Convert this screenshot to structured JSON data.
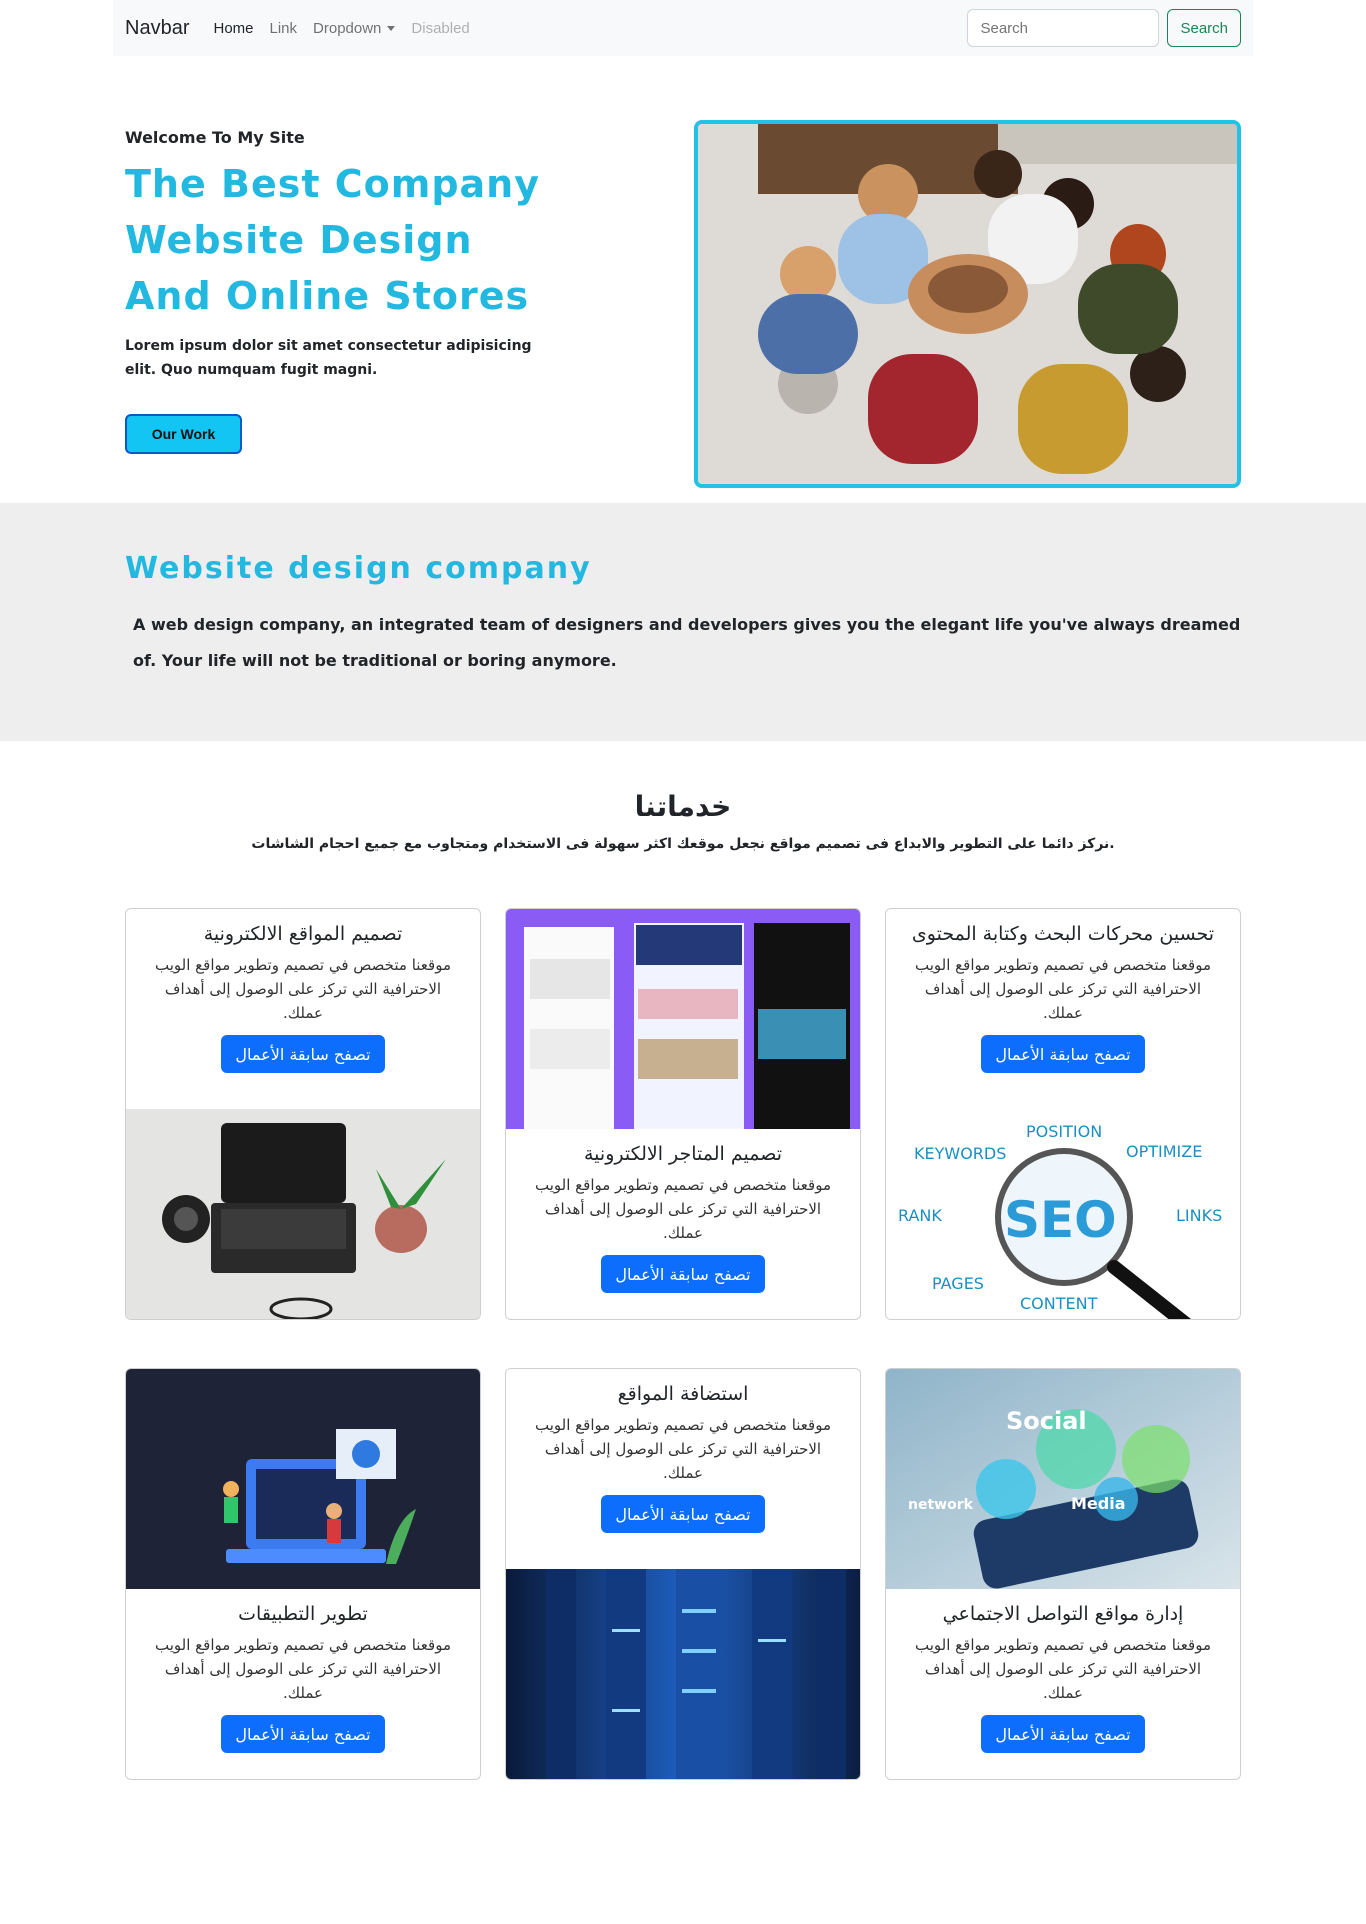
{
  "navbar": {
    "brand": "Navbar",
    "links": [
      "Home",
      "Link",
      "Dropdown",
      "Disabled"
    ],
    "search_placeholder": "Search",
    "search_button": "Search"
  },
  "hero": {
    "welcome": "Welcome To My Site",
    "title_lines": [
      "The Best Company",
      "Website Design",
      "And Online Stores"
    ],
    "text": "Lorem ipsum dolor sit amet consectetur adipisicing elit. Quo numquam fugit magni.",
    "button": "Our Work"
  },
  "about": {
    "title": "Website design company",
    "text": "A web design company, an integrated team of designers and developers gives you the elegant life you've always dreamed of. Your life will not be traditional or boring anymore."
  },
  "services": {
    "title": "خدماتنا",
    "subtitle": ".نركز دائما على التطوير والابداع فى تصميم مواقع نجعل موقعك اكثر سهولة فى الاستخدام ومتجاوب مع جميع احجام الشاشات",
    "cards": [
      {
        "title": "تصميم المواقع الالكترونية",
        "text": "موقعنا متخصص في تصميم وتطوير مواقع الويب الاحترافية التي تركز على الوصول إلى أهداف عملك.",
        "button": "تصفح سابقة الأعمال"
      },
      {
        "title": "تصميم المتاجر الالكترونية",
        "text": "موقعنا متخصص في تصميم وتطوير مواقع الويب الاحترافية التي تركز على الوصول إلى أهداف عملك.",
        "button": "تصفح سابقة الأعمال"
      },
      {
        "title": "تحسين محركات البحث وكتابة المحتوى",
        "text": "موقعنا متخصص في تصميم وتطوير مواقع الويب الاحترافية التي تركز على الوصول إلى أهداف عملك.",
        "button": "تصفح سابقة الأعمال"
      },
      {
        "title": "تطوير التطبيقات",
        "text": "موقعنا متخصص في تصميم وتطوير مواقع الويب الاحترافية التي تركز على الوصول إلى أهداف عملك.",
        "button": "تصفح سابقة الأعمال"
      },
      {
        "title": "استضافة المواقع",
        "text": "موقعنا متخصص في تصميم وتطوير مواقع الويب الاحترافية التي تركز على الوصول إلى أهداف عملك.",
        "button": "تصفح سابقة الأعمال"
      },
      {
        "title": "إدارة مواقع التواصل الاجتماعي",
        "text": "موقعنا متخصص في تصميم وتطوير مواقع الويب الاحترافية التي تركز على الوصول إلى أهداف عملك.",
        "button": "تصفح سابقة الأعمال"
      }
    ],
    "seo_words": {
      "position": "POSITION",
      "keywords": "KEYWORDS",
      "optimize": "OPTIMIZE",
      "rank": "RANK",
      "seo": "SEO",
      "links": "LINKS",
      "pages": "PAGES",
      "content": "CONTENT"
    },
    "social_words": {
      "social": "Social",
      "network": "network",
      "media": "Media"
    }
  },
  "colors": {
    "accent": "#22b8e0",
    "primary_button": "#0d6efd",
    "search_green": "#198754"
  }
}
